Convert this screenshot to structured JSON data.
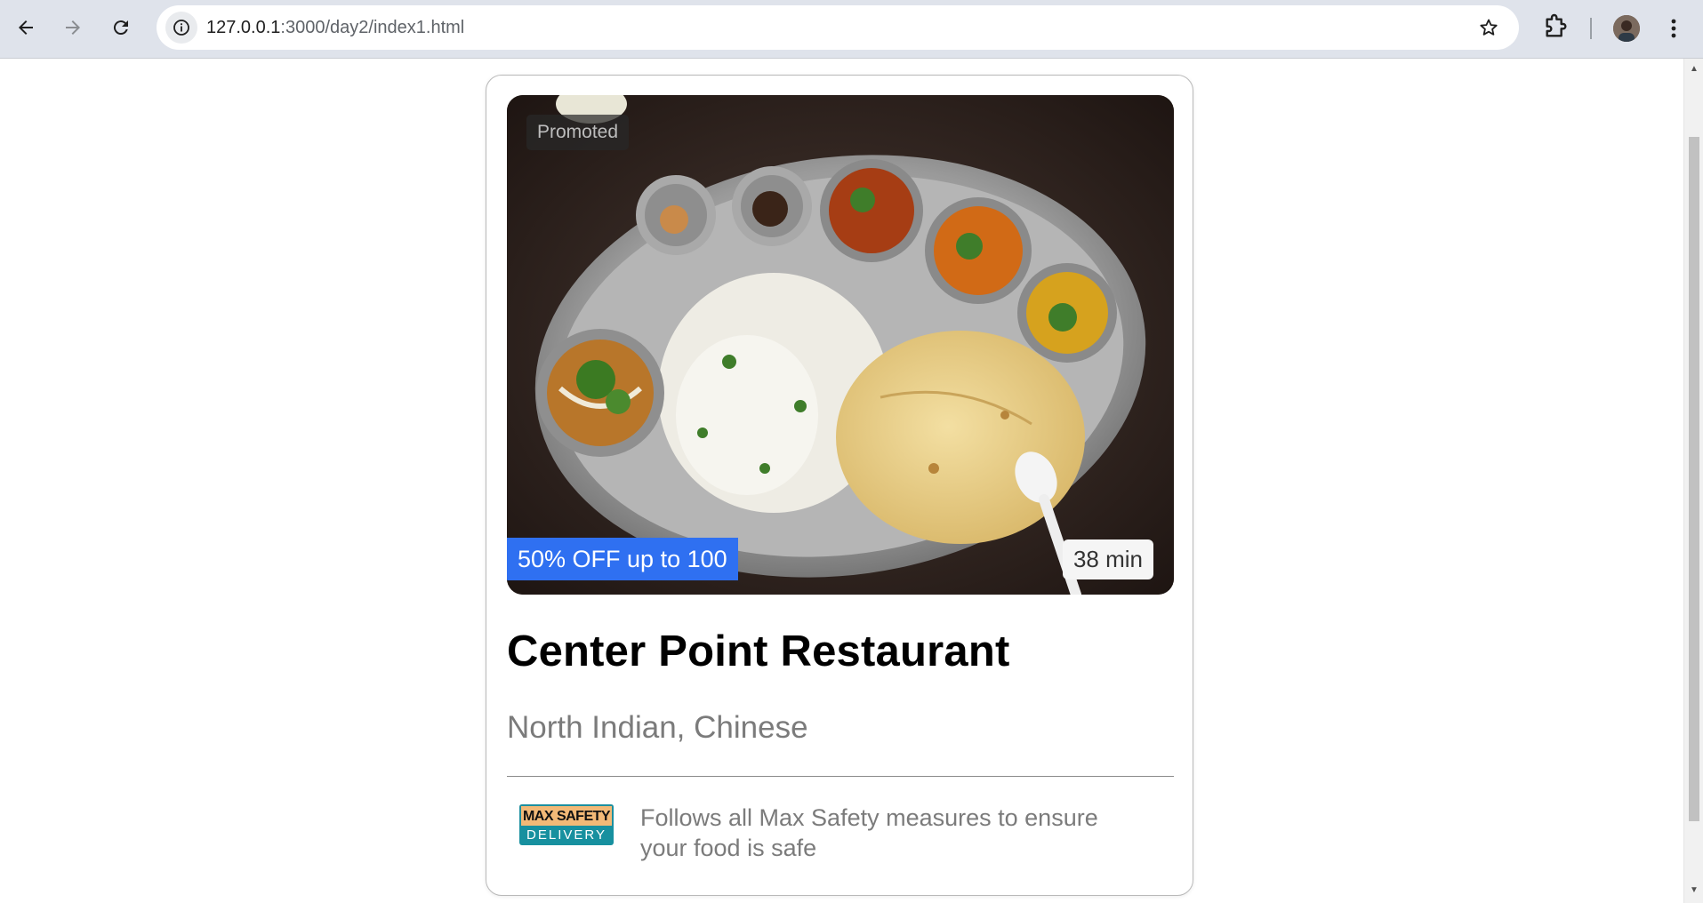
{
  "browser": {
    "url_host": "127.0.0.1",
    "url_path": ":3000/day2/index1.html"
  },
  "card": {
    "promoted_label": "Promoted",
    "offer_label": "50% OFF up to 100",
    "eta_label": "38 min",
    "title": "Center Point Restaurant",
    "cuisine": "North Indian, Chinese",
    "safety_logo_top": "MAX SAFETY",
    "safety_logo_bottom": "DELIVERY",
    "safety_text": "Follows all Max Safety measures to ensure your food is safe"
  },
  "colors": {
    "offer_bg": "#2f70f1",
    "logo_teal": "#17909f",
    "logo_orange": "#f2b977"
  }
}
